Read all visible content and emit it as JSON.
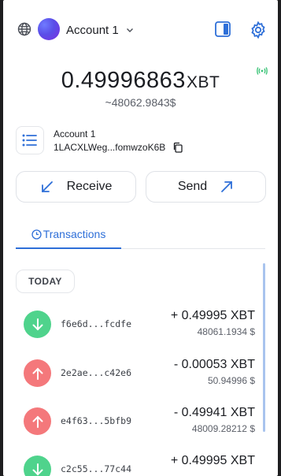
{
  "header": {
    "account_name": "Account 1",
    "globe_icon": "globe-icon",
    "panel_icon": "side-panel-icon",
    "settings_icon": "gear-icon",
    "accent": "#2e6fd8"
  },
  "balance": {
    "lead": "0.",
    "digits": "49996863",
    "symbol": "XBT",
    "fiat": "~48062.9843$"
  },
  "account_card": {
    "label": "Account 1",
    "address": "1LACXLWeg...fomwzoK6B"
  },
  "actions": {
    "receive_label": "Receive",
    "send_label": "Send"
  },
  "tabs": {
    "transactions_label": "Transactions"
  },
  "list": {
    "group_label": "TODAY",
    "transactions": [
      {
        "direction": "in",
        "hash": "f6e6d...fcdfe",
        "amount": "+ 0.49995 XBT",
        "fiat": "48061.1934 $"
      },
      {
        "direction": "out",
        "hash": "2e2ae...c42e6",
        "amount": "- 0.00053 XBT",
        "fiat": "50.94996 $"
      },
      {
        "direction": "out",
        "hash": "e4f63...5bfb9",
        "amount": "- 0.49941 XBT",
        "fiat": "48009.28212 $"
      },
      {
        "direction": "in",
        "hash": "c2c55...77c44",
        "amount": "+ 0.49995 XBT",
        "fiat": ""
      }
    ]
  },
  "colors": {
    "incoming": "#4fd38c",
    "outgoing": "#f4787b",
    "connected": "#3fc57a"
  }
}
